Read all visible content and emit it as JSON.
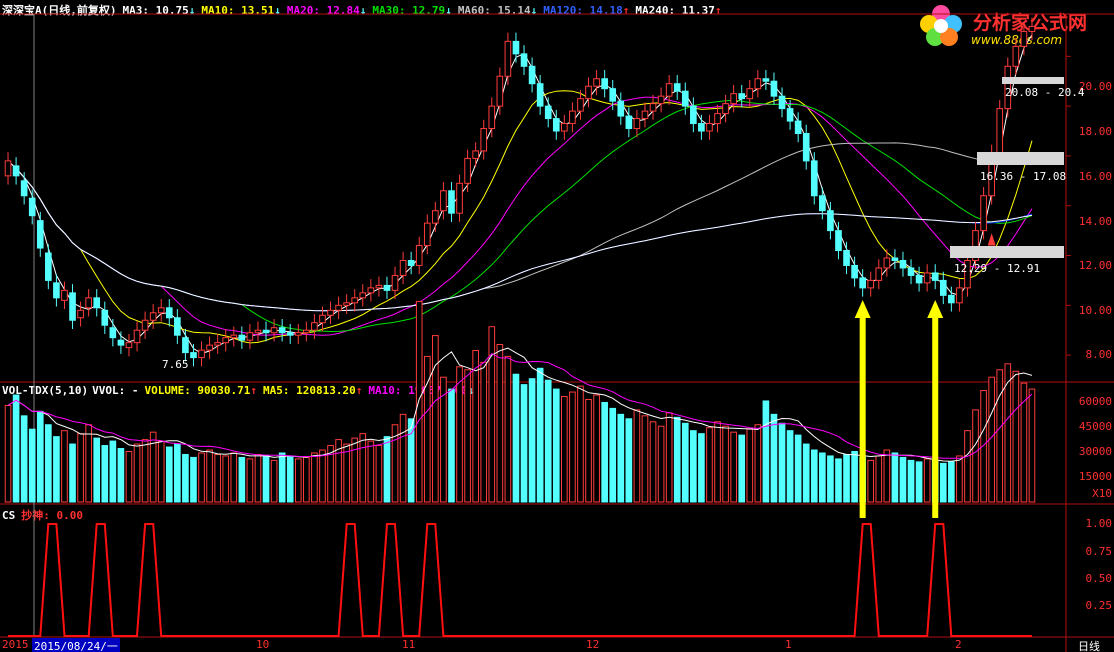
{
  "header": {
    "stock_name": "深深宝A",
    "period": "(日线,前复权)",
    "ma3": "MA3: 10.75",
    "ma3_arrow": "↓",
    "ma10": "MA10: 13.51",
    "ma10_arrow": "↓",
    "ma20": "MA20: 12.84",
    "ma20_arrow": "↓",
    "ma30": "MA30: 12.79",
    "ma30_arrow": "↓",
    "ma60": "MA60: 15.14",
    "ma60_arrow": "↓",
    "ma120": "MA120: 14.18",
    "ma120_arrow": "↑",
    "ma240": "MA240: 11.37",
    "ma240_arrow": "↑"
  },
  "logo": {
    "title": "分析家公式网",
    "url": "www.88gs.com"
  },
  "vol_header": {
    "name": "VOL-TDX(5,10)",
    "vvol": "VVOL: -",
    "volume": "VOLUME: 90030.71",
    "volume_arrow": "↑",
    "ma5": "MA5: 120813.20",
    "ma5_arrow": "↑",
    "ma10": "MA10: 190675.00",
    "ma10_arrow": "↓"
  },
  "cs_header": {
    "name": "CS",
    "label": "抄神: 0.00"
  },
  "price_axis": [
    "20.00",
    "18.00",
    "16.00",
    "14.00",
    "12.00",
    "10.00",
    "8.00"
  ],
  "vol_axis": [
    "60000",
    "45000",
    "30000",
    "15000"
  ],
  "vol_unit": "X10",
  "cs_axis": [
    "1.00",
    "0.75",
    "0.50",
    "0.25"
  ],
  "time_axis": {
    "start": "2015",
    "cursor_date": "2015/08/24/一",
    "m10": "10",
    "m11": "11",
    "m12": "12",
    "m1": "1",
    "m2": "2",
    "period": "日线"
  },
  "annotations": {
    "low_label": "7.65"
  },
  "bands": [
    {
      "label": "20.08 - 20.4",
      "lo": 20.08,
      "hi": 20.4
    },
    {
      "label": "16.36 - 17.08",
      "lo": 16.36,
      "hi": 17.08
    },
    {
      "label": "12.29 - 12.91",
      "lo": 12.29,
      "hi": 12.91
    }
  ],
  "colors": {
    "up": "#ff3c3c",
    "down": "#54ffff",
    "ma3": "#ffffff",
    "ma10": "#ffff00",
    "ma20": "#ff00ff",
    "ma30": "#00e000",
    "ma60": "#c0c0c0",
    "ma120": "#0030ff",
    "ma240": "#ffffff",
    "cs": "#ff1010",
    "arrow": "#ffff00"
  },
  "chart_data": {
    "type": "candlestick",
    "price_ylim": [
      7,
      21.7
    ],
    "close": [
      15.8,
      15.2,
      14.4,
      13.6,
      12.3,
      11.0,
      10.3,
      10.6,
      9.4,
      9.8,
      10.3,
      9.9,
      9.2,
      8.7,
      8.4,
      8.5,
      9.0,
      9.4,
      9.7,
      9.9,
      9.5,
      8.8,
      8.1,
      7.9,
      8.2,
      8.4,
      8.5,
      8.7,
      8.8,
      8.6,
      8.9,
      9.0,
      8.9,
      9.1,
      8.9,
      8.8,
      8.9,
      9.0,
      9.3,
      9.6,
      9.8,
      10.0,
      10.1,
      10.3,
      10.5,
      10.7,
      10.8,
      10.6,
      11.2,
      11.8,
      11.6,
      12.4,
      13.3,
      13.8,
      14.6,
      13.7,
      14.9,
      15.9,
      16.2,
      17.1,
      18.0,
      19.2,
      20.6,
      20.1,
      19.6,
      18.9,
      18.0,
      17.5,
      17.0,
      17.3,
      17.8,
      18.3,
      18.8,
      19.1,
      18.7,
      18.2,
      17.6,
      17.1,
      17.5,
      17.8,
      18.1,
      18.4,
      18.9,
      18.6,
      18.0,
      17.3,
      17.0,
      17.3,
      17.7,
      18.1,
      18.5,
      18.3,
      18.7,
      19.1,
      19.0,
      18.4,
      17.9,
      17.4,
      16.9,
      15.8,
      14.4,
      13.8,
      13.0,
      12.2,
      11.6,
      11.1,
      10.7,
      11.0,
      11.5,
      11.9,
      11.8,
      11.5,
      11.2,
      10.9,
      11.3,
      11.0,
      10.4,
      10.1,
      10.7,
      11.8,
      13.0,
      14.4,
      16.1,
      17.9,
      19.6,
      20.4,
      21.0,
      21.2
    ],
    "open": [
      15.2,
      15.6,
      15.0,
      14.3,
      13.4,
      12.1,
      10.9,
      10.2,
      10.5,
      9.5,
      9.9,
      10.3,
      9.8,
      9.1,
      8.6,
      8.3,
      8.5,
      9.0,
      9.4,
      9.7,
      9.9,
      9.5,
      8.7,
      8.1,
      7.9,
      8.2,
      8.4,
      8.5,
      8.7,
      8.8,
      8.6,
      8.9,
      9.0,
      8.9,
      9.1,
      8.9,
      8.8,
      8.9,
      9.0,
      9.3,
      9.6,
      9.8,
      10.0,
      10.1,
      10.3,
      10.5,
      10.7,
      10.8,
      10.6,
      11.2,
      11.8,
      11.6,
      12.4,
      13.3,
      13.8,
      14.6,
      13.7,
      14.9,
      15.9,
      16.2,
      17.1,
      18.0,
      19.2,
      20.6,
      20.1,
      19.6,
      18.9,
      18.0,
      17.5,
      17.0,
      17.3,
      17.8,
      18.3,
      18.8,
      19.1,
      18.7,
      18.2,
      17.6,
      17.1,
      17.5,
      17.8,
      18.1,
      18.4,
      18.9,
      18.6,
      18.0,
      17.3,
      17.0,
      17.3,
      17.7,
      18.1,
      18.5,
      18.3,
      18.7,
      19.1,
      19.0,
      18.4,
      17.9,
      17.4,
      16.9,
      15.8,
      14.4,
      13.8,
      13.0,
      12.2,
      11.6,
      11.1,
      10.7,
      11.0,
      11.5,
      11.9,
      11.8,
      11.5,
      11.2,
      10.9,
      11.3,
      11.0,
      10.4,
      10.1,
      10.7,
      11.8,
      13.0,
      14.4,
      16.1,
      17.9,
      19.6,
      20.4,
      21.0
    ],
    "volume": [
      6500,
      7200,
      5800,
      4900,
      6100,
      5200,
      4400,
      4800,
      3900,
      4600,
      5200,
      4300,
      3800,
      4100,
      3600,
      3400,
      3900,
      4200,
      4700,
      4100,
      3700,
      3900,
      3200,
      3000,
      3300,
      3500,
      3200,
      3100,
      3300,
      3000,
      2900,
      3200,
      3100,
      2800,
      3300,
      3100,
      2900,
      3000,
      3300,
      3500,
      3800,
      4200,
      3900,
      4300,
      4600,
      4100,
      3800,
      4400,
      5200,
      5900,
      5600,
      13500,
      9800,
      11200,
      8400,
      7600,
      9100,
      8900,
      10200,
      9400,
      11800,
      10600,
      9800,
      8600,
      7900,
      8300,
      9000,
      8200,
      7600,
      7100,
      7400,
      7800,
      6900,
      7200,
      6700,
      6300,
      5900,
      5600,
      6200,
      5800,
      5400,
      5100,
      6000,
      5700,
      5300,
      4800,
      4600,
      5000,
      5400,
      5100,
      4700,
      4500,
      4900,
      5200,
      6800,
      5900,
      5300,
      4800,
      4500,
      3900,
      3500,
      3300,
      3100,
      2900,
      3200,
      3400,
      3000,
      2800,
      3100,
      3500,
      3300,
      3000,
      2800,
      2700,
      2900,
      2800,
      2600,
      2700,
      3100,
      4800,
      6200,
      7500,
      8400,
      8900,
      9300,
      8800,
      8000,
      7600
    ],
    "cs_signal_indices": [
      5,
      11,
      17,
      42,
      47,
      52,
      106,
      115
    ],
    "arrow_indices": [
      106,
      115
    ]
  }
}
